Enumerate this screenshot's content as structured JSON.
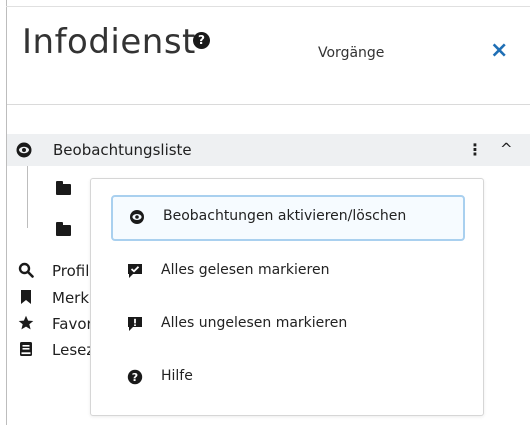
{
  "header": {
    "title": "Infodienst",
    "tab_label": "Vorgänge",
    "close_glyph": "×",
    "help_glyph": "?"
  },
  "watchlist": {
    "label": "Beobachtungsliste",
    "kebab_glyph": "⋮",
    "chevron_glyph": "^"
  },
  "side_items": [
    {
      "label": "Profile",
      "icon": "search-magnifier-icon"
    },
    {
      "label": "Merkliste",
      "icon": "bookmark-icon"
    },
    {
      "label": "Favoriten",
      "icon": "star-icon"
    },
    {
      "label": "Lesezeichen",
      "icon": "book-icon"
    }
  ],
  "context_menu": {
    "items": [
      {
        "label": "Beobachtungen aktivieren/löschen",
        "icon": "eye-icon"
      },
      {
        "label": "Alles gelesen markieren",
        "icon": "message-check-icon"
      },
      {
        "label": "Alles ungelesen markieren",
        "icon": "message-exclamation-icon"
      },
      {
        "label": "Hilfe",
        "icon": "help-circle-icon"
      }
    ]
  },
  "colors": {
    "accent": "#1f6fb5",
    "focus_border": "#a9d0ef",
    "row_highlight": "#eef0f2"
  }
}
